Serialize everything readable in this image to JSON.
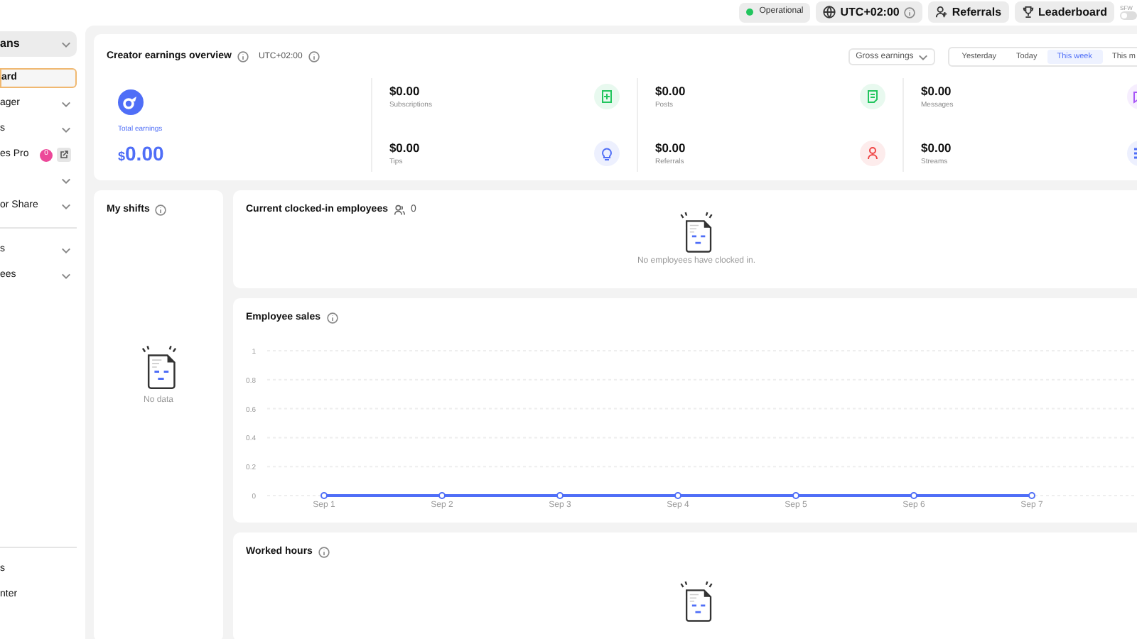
{
  "top_bar": {
    "status": {
      "label": "Operational",
      "color": "#22c55e"
    },
    "timezone": "UTC+02:00",
    "buttons": [
      {
        "label": "Referrals",
        "kind": "referrals"
      },
      {
        "label": "Leaderboard",
        "kind": "trophy"
      }
    ],
    "toggle": {
      "label": "SFW",
      "on": false
    }
  },
  "sidebar": {
    "account": "ans",
    "items": [
      {
        "label": "ard",
        "selected": true,
        "kind": "plain"
      },
      {
        "label": "ager",
        "selected": false,
        "kind": "expand"
      },
      {
        "label": "s",
        "selected": false,
        "kind": "expand"
      },
      {
        "label": "es Pro",
        "selected": false,
        "kind": "external",
        "badge": "0"
      },
      {
        "selected": false,
        "kind": "expand"
      },
      {
        "label": "or Share",
        "selected": false,
        "kind": "expand"
      },
      {
        "label": "s",
        "selected": false,
        "kind": "expand",
        "divider_before": true
      },
      {
        "label": "ees",
        "selected": false,
        "kind": "expand"
      }
    ],
    "footer_items": [
      {
        "label": "s"
      },
      {
        "label": "nter"
      }
    ]
  },
  "earnings": {
    "title": "Creator earnings overview",
    "timezone": "UTC+02:00",
    "filter": "Gross earnings",
    "periods": [
      {
        "label": "Yesterday",
        "selected": false
      },
      {
        "label": "Today",
        "selected": false
      },
      {
        "label": "This week",
        "selected": true
      },
      {
        "label": "This m",
        "selected": false
      }
    ],
    "total_label": "Total earnings",
    "total_currency": "$",
    "total_value": "0.00",
    "stats": [
      {
        "value": "$0.00",
        "label": "Subscriptions",
        "kind": "plus-doc",
        "color": "#22c55e"
      },
      {
        "value": "$0.00",
        "label": "Tips",
        "kind": "bulb",
        "color": "#4f6ef7"
      },
      {
        "value": "$0.00",
        "label": "Posts",
        "kind": "doc",
        "color": "#22c55e"
      },
      {
        "value": "$0.00",
        "label": "Referrals",
        "kind": "person",
        "color": "#ef4444"
      },
      {
        "value": "$0.00",
        "label": "Messages",
        "kind": "chat",
        "color": "#a855f7"
      },
      {
        "value": "$0.00",
        "label": "Streams",
        "kind": "stream",
        "color": "#4f6ef7"
      }
    ]
  },
  "my_shifts": {
    "title": "My shifts",
    "empty_text": "No data"
  },
  "clocked_in": {
    "title": "Current clocked-in employees",
    "count": "0",
    "empty_text": "No employees have clocked in."
  },
  "employee_sales": {
    "title": "Employee sales",
    "chart_data": {
      "type": "line",
      "categories": [
        "Sep 1",
        "Sep 2",
        "Sep 3",
        "Sep 4",
        "Sep 5",
        "Sep 6",
        "Sep 7"
      ],
      "series": [
        {
          "color": "#4f6ef7",
          "values": [
            0,
            0,
            0,
            0,
            0,
            0,
            0
          ],
          "marker": true
        }
      ],
      "grid": true,
      "ylim": [
        0,
        1
      ],
      "yticks": [
        0,
        0.2,
        0.4,
        0.6,
        0.8,
        1
      ]
    }
  },
  "worked_hours": {
    "title": "Worked hours"
  }
}
